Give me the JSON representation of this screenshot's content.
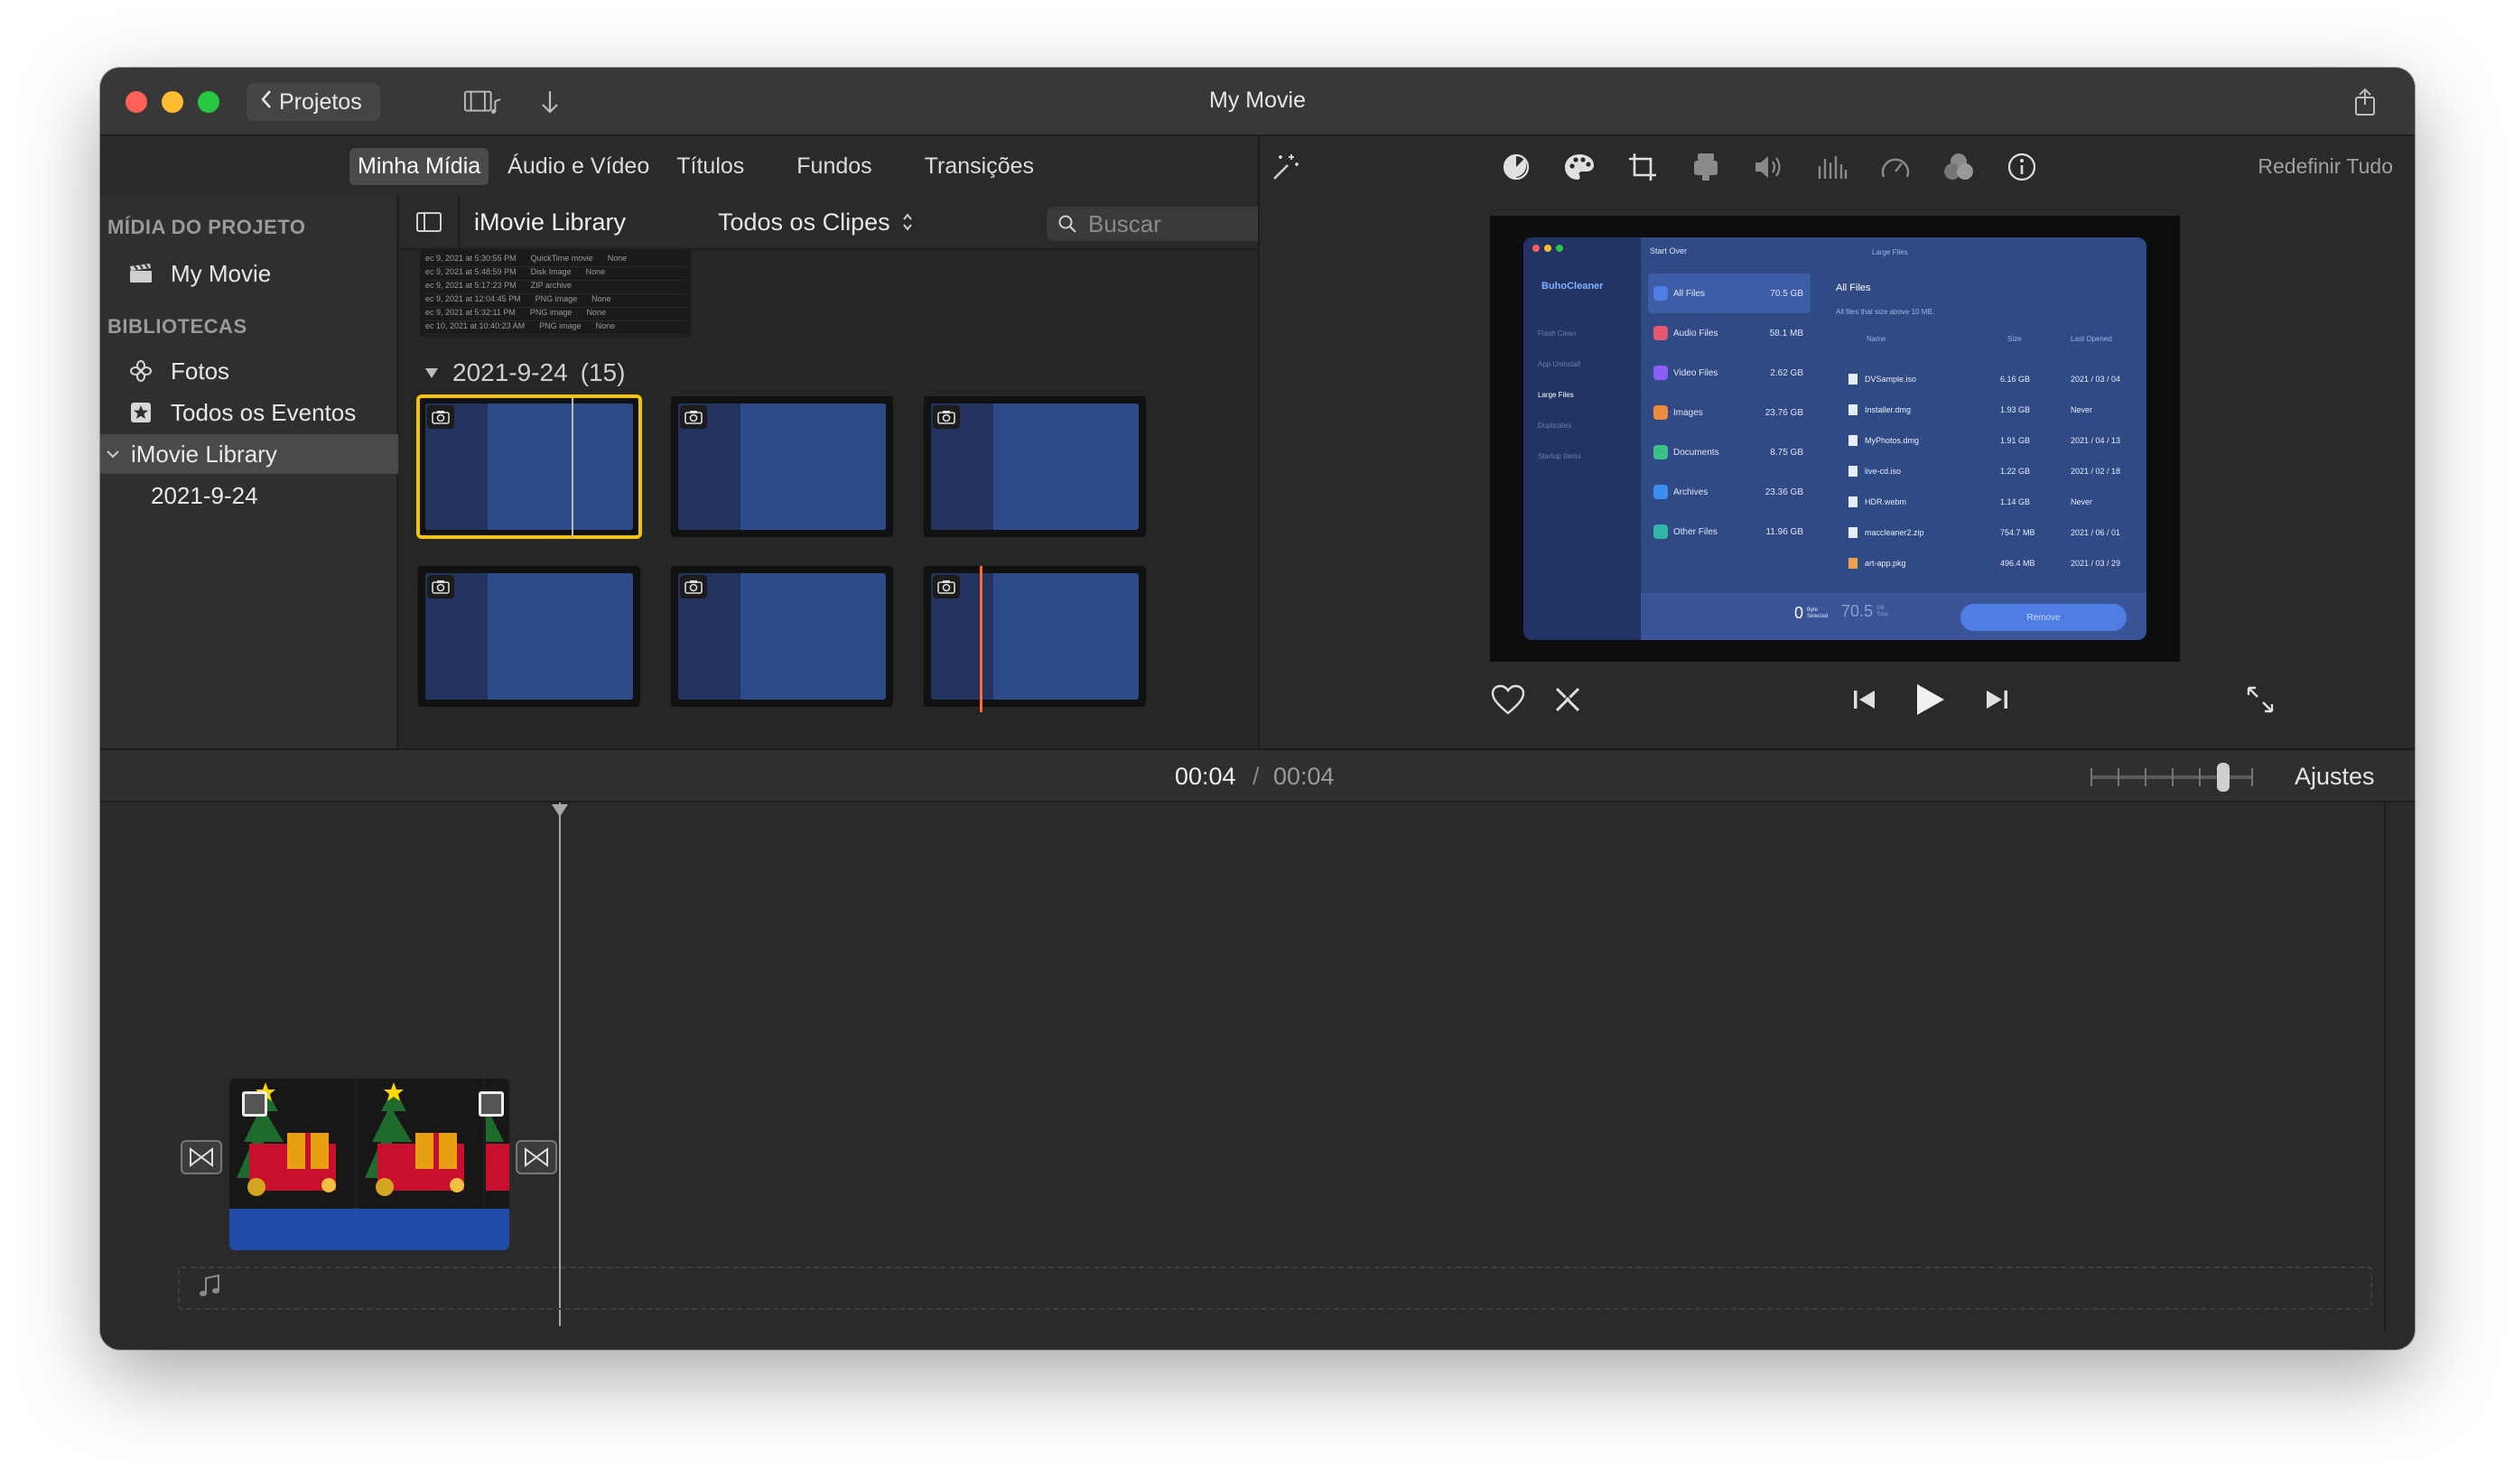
{
  "window": {
    "title": "My Movie",
    "back_label": "Projetos"
  },
  "media_tabs": [
    "Minha Mídia",
    "Áudio e Vídeo",
    "Títulos",
    "Fundos",
    "Transições"
  ],
  "sidebar": {
    "project_heading": "MÍDIA DO PROJETO",
    "project_item": "My Movie",
    "libraries_heading": "BIBLIOTECAS",
    "items": [
      {
        "label": "Fotos",
        "icon": "photos-icon"
      },
      {
        "label": "Todos os Eventos",
        "icon": "star-icon"
      },
      {
        "label": "iMovie Library",
        "icon": "chevron-down-icon"
      },
      {
        "label": "2021-9-24",
        "icon": ""
      }
    ]
  },
  "browser": {
    "library_name": "iMovie Library",
    "filter": "Todos os Clipes",
    "search_placeholder": "Buscar",
    "event_title": "2021-9-24",
    "event_count": "(15)",
    "table_rows": [
      [
        "ec 9, 2021 at 5:30:55 PM",
        "QuickTime movie",
        "None"
      ],
      [
        "ec 9, 2021 at 5:48:59 PM",
        "Disk Image",
        "None"
      ],
      [
        "ec 9, 2021 at 5:17:23 PM",
        "ZIP archive",
        ""
      ],
      [
        "ec 9, 2021 at 12:04:45 PM",
        "PNG image",
        "None"
      ],
      [
        "ec 9, 2021 at 5:32:11 PM",
        "PNG image",
        "None"
      ],
      [
        "ec 10, 2021 at 10:40:23 AM",
        "PNG image",
        "None"
      ]
    ]
  },
  "viewer": {
    "reset_label": "Redefinir Tudo",
    "app": {
      "brand": "BuhoCleaner",
      "back_label": "Start Over",
      "header": "Large Files",
      "list_title": "All Files",
      "list_subtitle": "All files that size above 10 MB.",
      "columns": [
        "Name",
        "Size",
        "Last Opened"
      ],
      "side_items": [
        "Flash Clean",
        "App Uninstall",
        "Large Files",
        "Duplicates",
        "Startup Items"
      ],
      "categories": [
        {
          "name": "All Files",
          "size": "70.5 GB",
          "color": "#4e7de3"
        },
        {
          "name": "Audio Files",
          "size": "58.1 MB",
          "color": "#e25a6b"
        },
        {
          "name": "Video Files",
          "size": "2.62 GB",
          "color": "#8b5cf6"
        },
        {
          "name": "Images",
          "size": "23.76 GB",
          "color": "#f08a3c"
        },
        {
          "name": "Documents",
          "size": "8.75 GB",
          "color": "#3cc08a"
        },
        {
          "name": "Archives",
          "size": "23.36 GB",
          "color": "#3c8ef0"
        },
        {
          "name": "Other Files",
          "size": "11.96 GB",
          "color": "#2fb8a8"
        }
      ],
      "files": [
        {
          "name": "DVSample.iso",
          "size": "6.16 GB",
          "date": "2021 / 03 / 04"
        },
        {
          "name": "Installer.dmg",
          "size": "1.93 GB",
          "date": "Never"
        },
        {
          "name": "MyPhotos.dmg",
          "size": "1.91 GB",
          "date": "2021 / 04 / 13"
        },
        {
          "name": "live-cd.iso",
          "size": "1.22 GB",
          "date": "2021 / 02 / 18"
        },
        {
          "name": "HDR.webm",
          "size": "1.14 GB",
          "date": "Never"
        },
        {
          "name": "maccleaner2.zip",
          "size": "754.7 MB",
          "date": "2021 / 06 / 01"
        },
        {
          "name": "art-app.pkg",
          "size": "496.4 MB",
          "date": "2021 / 03 / 29"
        }
      ],
      "selected_count": "0",
      "selected_unit": "Byte",
      "selected_label": "Selected",
      "total": "70.5",
      "total_unit": "GB",
      "total_label": "Total",
      "remove_label": "Remove"
    }
  },
  "timeline": {
    "current_time": "00:04",
    "separator": "/",
    "total_time": "00:04",
    "settings_label": "Ajustes",
    "zoom_level": 0.78
  },
  "colors": {
    "selection_outline": "#f5c400",
    "audio_track": "#1f4aa8",
    "skimmer": "#ff6a2a"
  }
}
